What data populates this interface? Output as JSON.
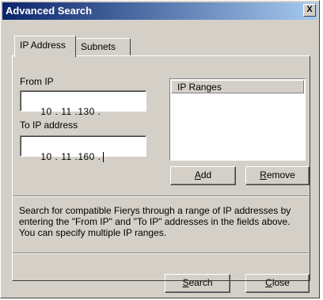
{
  "window": {
    "title": "Advanced Search",
    "close_glyph": "X"
  },
  "tabs": [
    {
      "label": "IP Address",
      "active": true
    },
    {
      "label": "Subnets",
      "active": false
    }
  ],
  "from_ip": {
    "label": "From IP",
    "value": "10 . 11 .130 ."
  },
  "to_ip": {
    "label": "To IP address",
    "value": "10 . 11 .160 ."
  },
  "ip_ranges": {
    "header": "IP Ranges",
    "items": []
  },
  "buttons": {
    "add": {
      "mnemonic": "A",
      "rest": "dd"
    },
    "remove": {
      "mnemonic": "R",
      "rest": "emove"
    },
    "search": {
      "mnemonic": "S",
      "rest": "earch"
    },
    "close": {
      "mnemonic": "C",
      "rest": "lose"
    }
  },
  "description": "Search for compatible Fierys through a range of IP addresses by entering the \"From IP\" and \"To IP\" addresses in the fields above.  You can specify multiple IP ranges.",
  "colors": {
    "face": "#d4d0c8",
    "title_start": "#0a246a",
    "title_end": "#a6caf0"
  }
}
